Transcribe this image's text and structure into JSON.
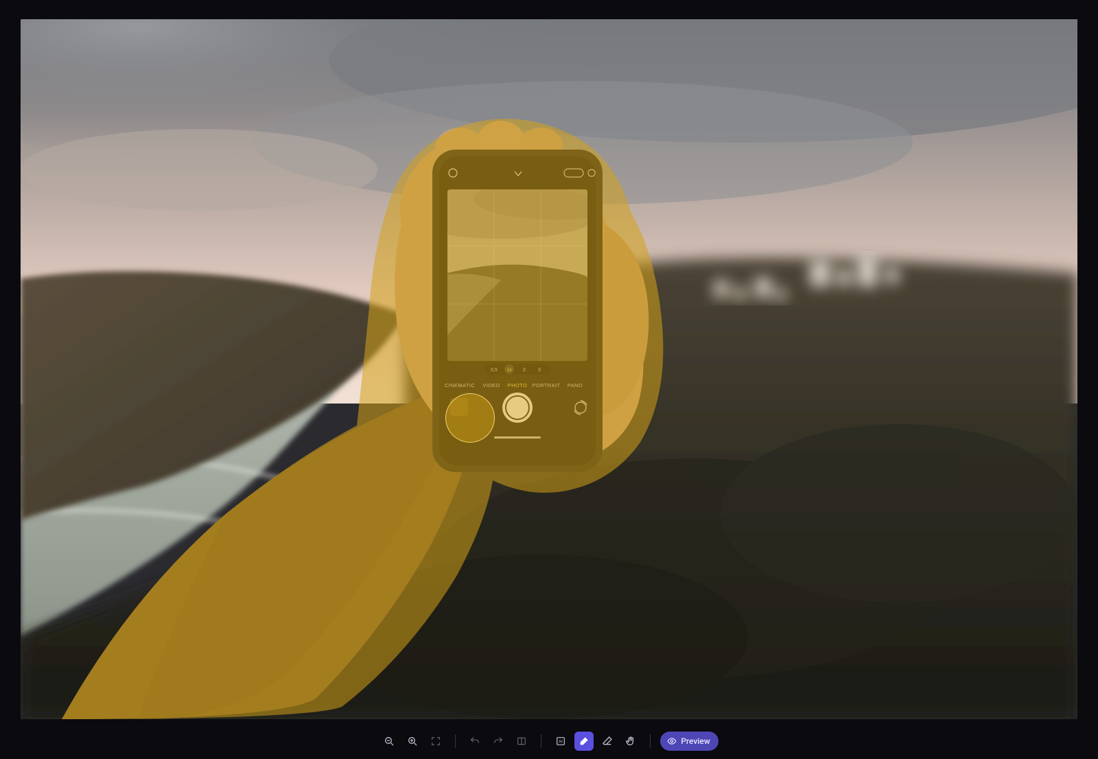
{
  "canvas": {
    "selection_overlay_color": "#d4a318",
    "selection_overlay_opacity": 0.55,
    "phone_camera_modes": [
      "CINEMATIC",
      "VIDEO",
      "PHOTO",
      "PORTRAIT",
      "PANO"
    ],
    "phone_camera_mode_active": "PHOTO",
    "phone_zoom_levels": [
      "0,5",
      "1x",
      "2",
      "3"
    ]
  },
  "toolbar": {
    "zoom_out": "zoom-out",
    "zoom_in": "zoom-in",
    "fit": "fit-screen",
    "undo": "undo",
    "redo": "redo",
    "compare": "compare",
    "ai_select": "ai-select",
    "brush": "brush",
    "eraser": "eraser",
    "pan": "pan",
    "preview_label": "Preview",
    "active_tool": "brush"
  }
}
